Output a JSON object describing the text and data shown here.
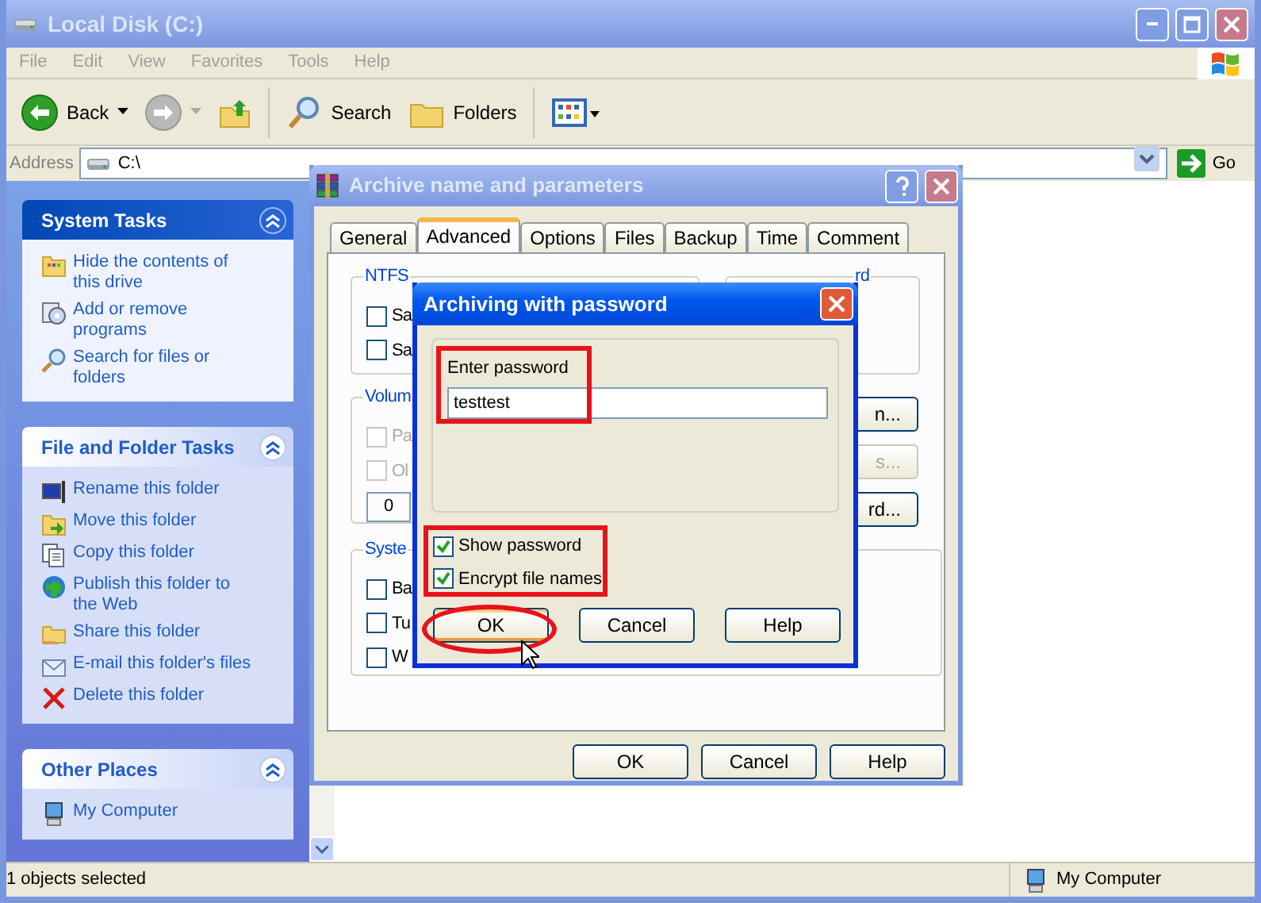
{
  "window": {
    "title": "Local Disk (C:)"
  },
  "menu": [
    "File",
    "Edit",
    "View",
    "Favorites",
    "Tools",
    "Help"
  ],
  "toolbar": [
    {
      "kind": "back",
      "label": "Back"
    },
    {
      "kind": "forward"
    },
    {
      "kind": "up"
    },
    {
      "kind": "search",
      "label": "Search"
    },
    {
      "kind": "folders",
      "label": "Folders"
    },
    {
      "kind": "views"
    }
  ],
  "address": {
    "label": "Address",
    "value": "C:\\",
    "go": "Go"
  },
  "task_panels": [
    {
      "title": "System Tasks",
      "kind": "special",
      "items": [
        "Hide the contents of this drive",
        "Add or remove programs",
        "Search for files or folders"
      ]
    },
    {
      "title": "File and Folder Tasks",
      "kind": "normal",
      "items": [
        "Rename this folder",
        "Move this folder",
        "Copy this folder",
        "Publish this folder to the Web",
        "Share this folder",
        "E-mail this folder's files",
        "Delete this folder"
      ]
    },
    {
      "title": "Other Places",
      "kind": "normal",
      "items": [
        "My Computer"
      ]
    }
  ],
  "status_bar": {
    "text": "1 objects selected",
    "zone": "My Computer"
  },
  "archive_dialog": {
    "title": "Archive name and parameters",
    "tabs": [
      {
        "label": "General",
        "selected": false
      },
      {
        "label": "Advanced",
        "selected": true
      },
      {
        "label": "Options",
        "selected": false
      },
      {
        "label": "Files",
        "selected": false
      },
      {
        "label": "Backup",
        "selected": false
      },
      {
        "label": "Time",
        "selected": false
      },
      {
        "label": "Comment",
        "selected": false
      }
    ],
    "ntfs_group": {
      "title": "NTFS",
      "options": [
        {
          "label": "Sa",
          "checked": false,
          "disabled": false
        },
        {
          "label": "Sa",
          "checked": false,
          "disabled": false
        }
      ]
    },
    "password_group": {
      "title": "rd"
    },
    "volume_group": {
      "title": "Volum",
      "options": [
        {
          "label": "Pa",
          "checked": false,
          "disabled": true
        },
        {
          "label": "Ol",
          "checked": false,
          "disabled": true
        }
      ],
      "value": "0"
    },
    "side_buttons": [
      {
        "label": "n...",
        "disabled": false
      },
      {
        "label": "s...",
        "disabled": true
      },
      {
        "label": "rd...",
        "disabled": false
      }
    ],
    "system_group": {
      "title": "Syste",
      "options": [
        {
          "label": "Ba",
          "checked": false,
          "disabled": false
        },
        {
          "label": "Tu",
          "checked": false,
          "disabled": false
        },
        {
          "label": "W",
          "checked": false,
          "disabled": false
        }
      ]
    },
    "buttons": [
      "OK",
      "Cancel",
      "Help"
    ]
  },
  "password_dialog": {
    "title": "Archiving with password",
    "prompt": "Enter password",
    "value": "testtest",
    "options": [
      {
        "label": "Show password",
        "checked": true
      },
      {
        "label": "Encrypt file names",
        "checked": true
      }
    ],
    "buttons": [
      {
        "label": "OK",
        "focused": true
      },
      {
        "label": "Cancel",
        "focused": false
      },
      {
        "label": "Help",
        "focused": false
      }
    ]
  }
}
